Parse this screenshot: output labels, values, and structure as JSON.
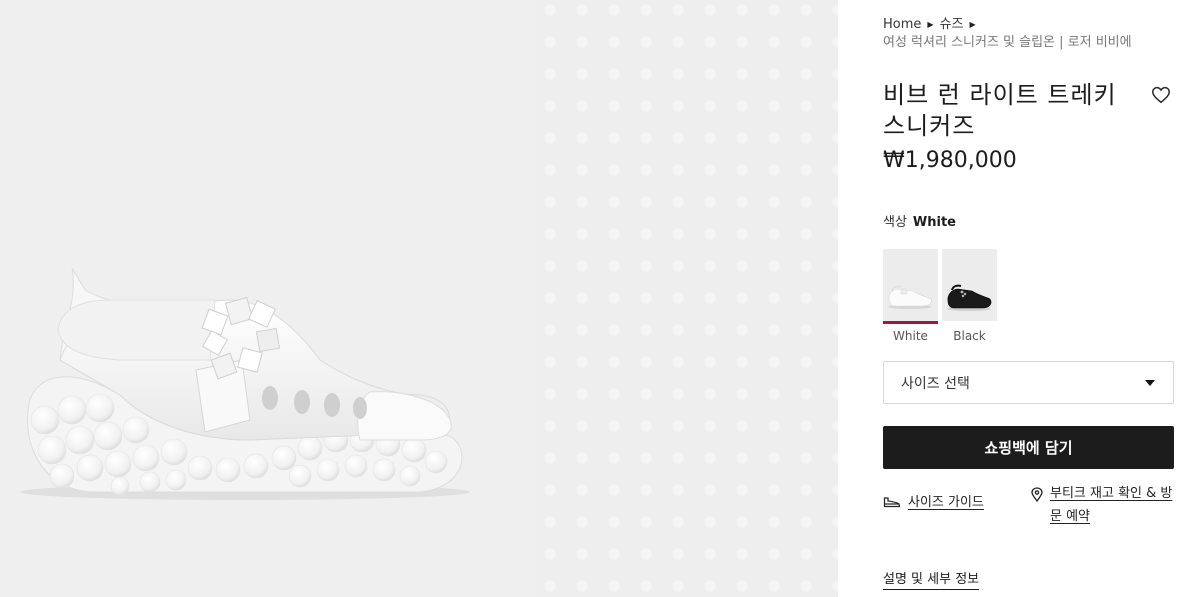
{
  "breadcrumb": {
    "home": "Home",
    "category": "슈즈",
    "subcategory": "여성 럭셔리 스니커즈 및 슬립온 | 로저 비비에"
  },
  "product": {
    "title": "비브 런 라이트 트레키 스니커즈",
    "price": "₩1,980,000"
  },
  "color": {
    "label": "색상",
    "selected": "White",
    "options": [
      {
        "name": "White"
      },
      {
        "name": "Black"
      }
    ],
    "active_color": "#a3163d"
  },
  "size": {
    "placeholder": "사이즈 선택"
  },
  "actions": {
    "add_to_bag": "쇼핑백에 담기",
    "size_guide": "사이즈 가이드",
    "store_stock": "부티크 재고 확인 & 방문 예약",
    "details": "설명 및 세부 정보"
  },
  "icons": {
    "wishlist": "heart-outline-icon",
    "size_guide": "shoe-icon",
    "store": "location-pin-icon",
    "dropdown": "caret-down-icon"
  }
}
